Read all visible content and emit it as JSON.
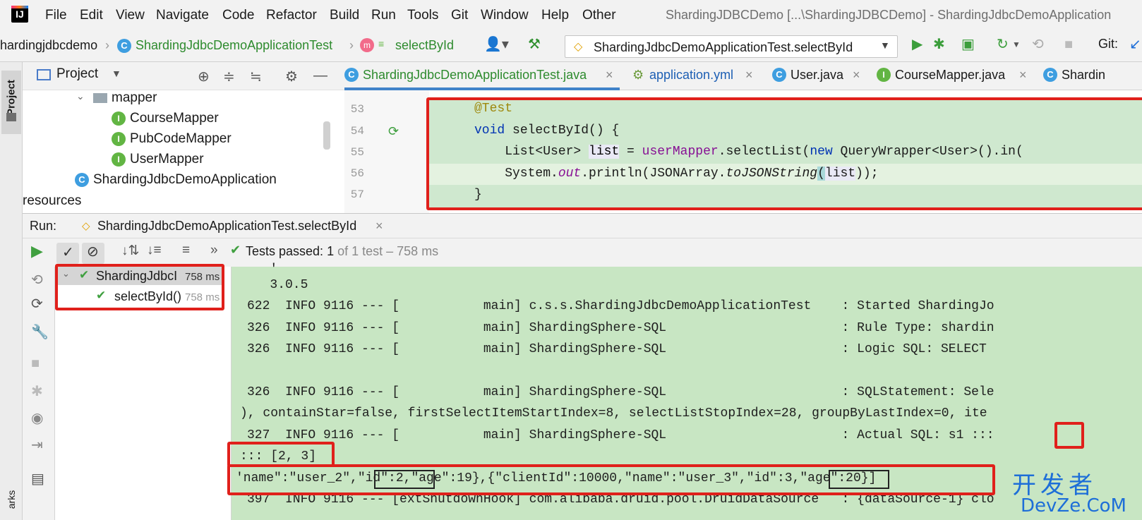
{
  "menu": [
    "File",
    "Edit",
    "View",
    "Navigate",
    "Code",
    "Refactor",
    "Build",
    "Run",
    "Tools",
    "Git",
    "Window",
    "Help",
    "Other"
  ],
  "window_title": "ShardingJDBCDemo [...\\ShardingJDBCDemo] - ShardingJdbcDemoApplication",
  "nav": {
    "crumb_project": "hardingjdbcdemo",
    "crumb_class": "ShardingJdbcDemoApplicationTest",
    "crumb_method": "selectById",
    "run_config": "ShardingJdbcDemoApplicationTest.selectById",
    "git_label": "Git:"
  },
  "project": {
    "header_label": "Project",
    "tree": {
      "mapper": "mapper",
      "course_mapper": "CourseMapper",
      "pubcode_mapper": "PubCodeMapper",
      "user_mapper": "UserMapper",
      "app": "ShardingJdbcDemoApplication",
      "resources": "resources"
    },
    "stripe_label": "Project",
    "bookmarks_label": "arks"
  },
  "editor": {
    "tabs": [
      "ShardingJdbcDemoApplicationTest.java",
      "application.yml",
      "User.java",
      "CourseMapper.java",
      "Shardin"
    ],
    "line_numbers": [
      "53",
      "54",
      "55",
      "56",
      "57"
    ],
    "lines": {
      "l53": "@Test",
      "l54_kw": "void",
      "l54_rest": " selectById() {",
      "l55_a": "    List<User> ",
      "l55_list": "list",
      "l55_b": " = ",
      "l55_field": "userMapper",
      "l55_c": ".selectList(",
      "l55_new": "new",
      "l55_d": " QueryWrapper<User>().in(",
      "l56_a": "    System.",
      "l56_out": "out",
      "l56_b": ".println(JSONArray.",
      "l56_method": "toJSONString",
      "l56_c": "(",
      "l56_list": "list",
      "l56_d": "));",
      "l57": "}"
    }
  },
  "run": {
    "label": "Run:",
    "tab": "ShardingJdbcDemoApplicationTest.selectById",
    "status_passed": "Tests passed:",
    "status_count": "1",
    "status_rest": "of 1 test – 758 ms",
    "tree_root": "ShardingJdbcI",
    "tree_root_time": "758 ms",
    "tree_child": "selectById()",
    "tree_child_time": "758 ms"
  },
  "console": {
    "l0": "   '",
    "l1": "   3.0.5",
    "l2": "622  INFO 9116 --- [           main] c.s.s.ShardingJdbcDemoApplicationTest    : Started ShardingJo",
    "l3": "326  INFO 9116 --- [           main] ShardingSphere-SQL                       : Rule Type: shardin",
    "l4": "326  INFO 9116 --- [           main] ShardingSphere-SQL                       : Logic SQL: SELECT",
    "l5": "",
    "l6": "326  INFO 9116 --- [           main] ShardingSphere-SQL                       : SQLStatement: Sele",
    "l7": "), containStar=false, firstSelectItemStartIndex=8, selectListStopIndex=28, groupByLastIndex=0, ite",
    "l8a": "327  INFO 9116 --- [           main] ShardingSphere-SQL                       : Actual SQL: ",
    "l8b": "s1",
    "l8c": " :::",
    "l9": "::: [2, 3]",
    "l10a": "'name\":\"user_2\",",
    "l10b": "\"id\":2,",
    "l10c": "\"age\":19},{\"clientId\":10000,\"name\":\"user_3\",",
    "l10d": "\"id\":3,",
    "l10e": "\"age\":20}]",
    "l11": "397  INFO 9116 --- [extShutdownHook] com.alibaba.druid.pool.DruidDataSource   : {dataSource-1} clo"
  },
  "watermark": {
    "cn": "开发者",
    "en": "DevZe.CoM"
  },
  "colors": {
    "highlight_green": "#cfe8cf",
    "console_green": "#c8e6c3",
    "annotation_red": "#e0201b",
    "keyword": "#0033b3",
    "annotation": "#9e880d",
    "field": "#871094",
    "pass_green": "#40a040"
  }
}
